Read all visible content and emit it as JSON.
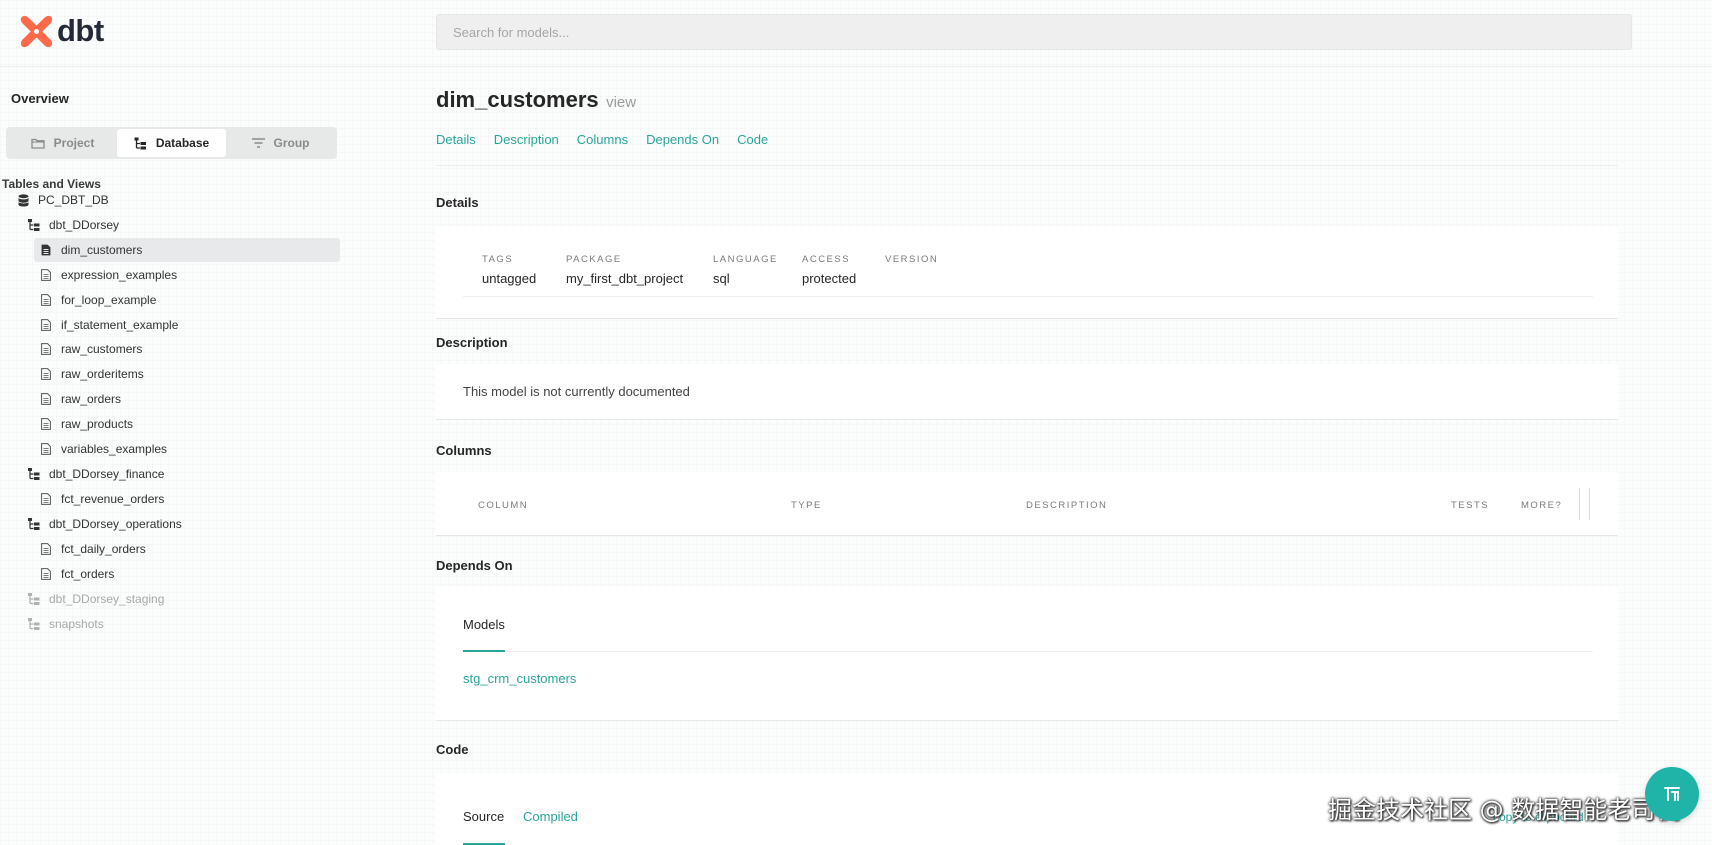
{
  "app": {
    "logo_text": "dbt",
    "brand_color": "#ff694a",
    "accent_color": "#2ba59c"
  },
  "search": {
    "placeholder": "Search for models..."
  },
  "sidebar": {
    "overview": "Overview",
    "switcher": [
      {
        "label": "Project",
        "icon": "folder-icon",
        "active": false
      },
      {
        "label": "Database",
        "icon": "database-tree-icon",
        "active": true
      },
      {
        "label": "Group",
        "icon": "filter-lines-icon",
        "active": false
      }
    ],
    "heading": "Tables and Views",
    "tree": [
      {
        "label": "PC_DBT_DB",
        "icon": "database-icon",
        "level": 0
      },
      {
        "label": "dbt_DDorsey",
        "icon": "schema-tree-icon",
        "level": 1
      },
      {
        "label": "dim_customers",
        "icon": "document-icon",
        "level": 2,
        "selected": true
      },
      {
        "label": "expression_examples",
        "icon": "document-icon",
        "level": 2
      },
      {
        "label": "for_loop_example",
        "icon": "document-icon",
        "level": 2
      },
      {
        "label": "if_statement_example",
        "icon": "document-icon",
        "level": 2
      },
      {
        "label": "raw_customers",
        "icon": "document-icon",
        "level": 2
      },
      {
        "label": "raw_orderitems",
        "icon": "document-icon",
        "level": 2
      },
      {
        "label": "raw_orders",
        "icon": "document-icon",
        "level": 2
      },
      {
        "label": "raw_products",
        "icon": "document-icon",
        "level": 2
      },
      {
        "label": "variables_examples",
        "icon": "document-icon",
        "level": 2
      },
      {
        "label": "dbt_DDorsey_finance",
        "icon": "schema-tree-icon",
        "level": 1
      },
      {
        "label": "fct_revenue_orders",
        "icon": "document-icon",
        "level": 2
      },
      {
        "label": "dbt_DDorsey_operations",
        "icon": "schema-tree-icon",
        "level": 1
      },
      {
        "label": "fct_daily_orders",
        "icon": "document-icon",
        "level": 2
      },
      {
        "label": "fct_orders",
        "icon": "document-icon",
        "level": 2
      },
      {
        "label": "dbt_DDorsey_staging",
        "icon": "schema-tree-icon",
        "level": 1,
        "muted": true
      },
      {
        "label": "snapshots",
        "icon": "schema-tree-icon",
        "level": 1,
        "muted": true
      }
    ]
  },
  "model": {
    "name": "dim_customers",
    "kind": "view",
    "tabs": [
      "Details",
      "Description",
      "Columns",
      "Depends On",
      "Code"
    ]
  },
  "details": {
    "title": "Details",
    "fields": [
      {
        "key": "TAGS",
        "value": "untagged"
      },
      {
        "key": "PACKAGE",
        "value": "my_first_dbt_project"
      },
      {
        "key": "LANGUAGE",
        "value": "sql"
      },
      {
        "key": "ACCESS",
        "value": "protected"
      },
      {
        "key": "VERSION",
        "value": ""
      }
    ]
  },
  "description": {
    "title": "Description",
    "text": "This model is not currently documented"
  },
  "columns": {
    "title": "Columns",
    "headers": [
      "COLUMN",
      "TYPE",
      "DESCRIPTION",
      "TESTS",
      "MORE?"
    ]
  },
  "depends_on": {
    "title": "Depends On",
    "tab": "Models",
    "items": [
      "stg_crm_customers"
    ]
  },
  "code": {
    "title": "Code",
    "tabs": [
      "Source",
      "Compiled"
    ],
    "copy_label": "copy to clipboard"
  },
  "watermark": "掘金技术社区 @ 数据智能老司机"
}
